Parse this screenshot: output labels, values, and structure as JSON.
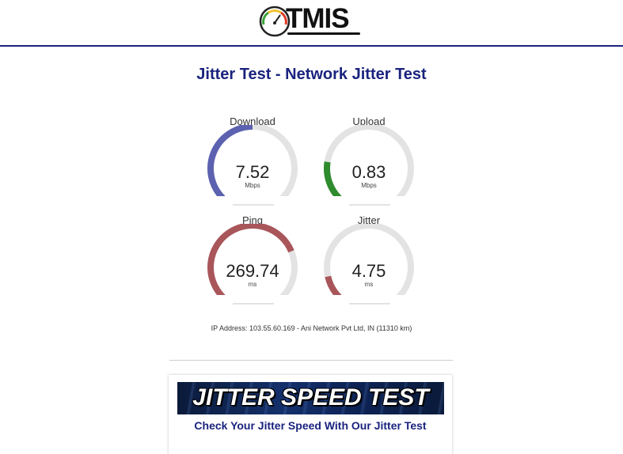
{
  "header": {
    "logo_text": "TMIS",
    "logo_icon": "speedometer-icon"
  },
  "page": {
    "title": "Jitter Test - Network Jitter Test"
  },
  "meters": [
    {
      "label": "Download",
      "value": "7.52",
      "unit": "Mbps",
      "fraction": 0.5,
      "color": "#5c62b0"
    },
    {
      "label": "Upload",
      "value": "0.83",
      "unit": "Mbps",
      "fraction": 0.2,
      "color": "#2e8b2e"
    },
    {
      "label": "Ping",
      "value": "269.74",
      "unit": "ms",
      "fraction": 0.75,
      "color": "#a9565a"
    },
    {
      "label": "Jitter",
      "value": "4.75",
      "unit": "ms",
      "fraction": 0.12,
      "color": "#a9565a"
    }
  ],
  "ip_info": "IP Address: 103.55.60.169 - Ani Network Pvt Ltd, IN (11310 km)",
  "promo": {
    "banner_text": "JITTER SPEED TEST",
    "heading": "Check Your Jitter Speed With Our Jitter Test",
    "text": ""
  },
  "colors": {
    "accent": "#1a237e",
    "track": "#e3e3e3"
  }
}
